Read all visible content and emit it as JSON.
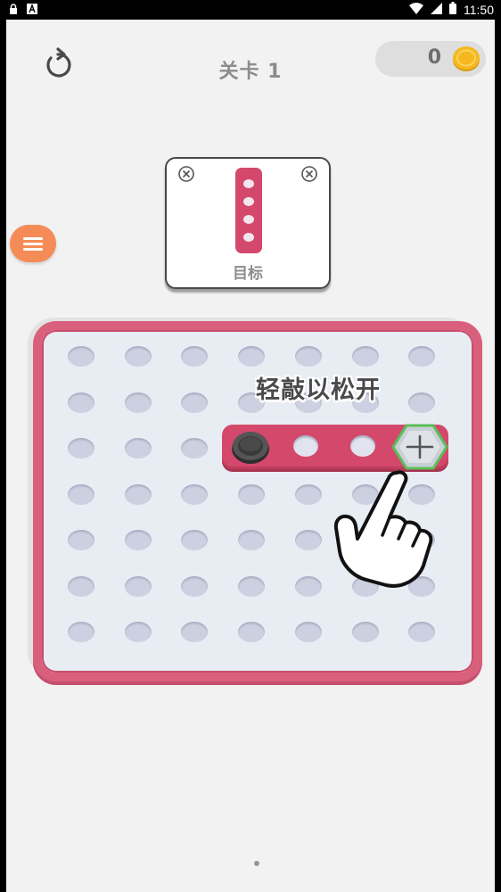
{
  "status_bar": {
    "time": "11:50",
    "icons": [
      "lock-icon",
      "app-a-icon",
      "wifi-icon",
      "signal-icon",
      "battery-icon"
    ]
  },
  "header": {
    "level_title": "关卡 1",
    "coins": "0",
    "restart_icon": "restart-icon",
    "coin_icon": "coin-icon"
  },
  "menu": {
    "icon": "menu-icon"
  },
  "target": {
    "label": "目标"
  },
  "board": {
    "hint_text": "轻敲以松开",
    "rows": 7,
    "cols": 7
  },
  "colors": {
    "board_frame": "#d9607c",
    "plank": "#d4486b",
    "menu_button": "#f58c57",
    "coin": "#f5b820",
    "hex_screw_outline": "#5bbf57"
  }
}
